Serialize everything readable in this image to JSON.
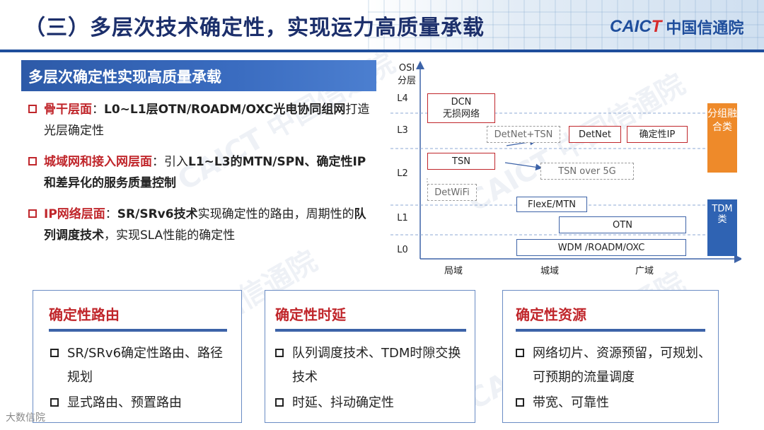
{
  "header": {
    "title": "（三）多层次技术确定性，实现运力高质量承载",
    "logo_mark_a": "CAIC",
    "logo_mark_b": "T",
    "logo_cn": "中国信通院"
  },
  "section": {
    "title": "多层次确定性实现高质量承载"
  },
  "bullets": [
    {
      "lead": "骨干层面",
      "sep": "：",
      "bold": "L0~L1层OTN/ROADM/OXC光电协同组网",
      "rest": "打造光层确定性"
    },
    {
      "lead": "城域网和接入网层面",
      "sep": "：引入",
      "bold": "L1~L3的MTN/SPN、确定性IP和差异化的服务质量控制",
      "rest": ""
    },
    {
      "lead": "IP网络层面",
      "sep": "：",
      "bold": "SR/SRv6技术",
      "rest": "实现确定性的路由，周期性的",
      "bold2": "队列调度技术",
      "rest2": "，实现SLA性能的确定性"
    }
  ],
  "diagram": {
    "y_axis_title_line1": "OSI",
    "y_axis_title_line2": "分层",
    "levels": [
      "L4",
      "L3",
      "L2",
      "L1",
      "L0"
    ],
    "x_labels": [
      "局域",
      "城域",
      "广域"
    ],
    "boxes": {
      "dcn": "DCN",
      "dcn_sub": "无损网络",
      "detnet_tsn": "DetNet+TSN",
      "detnet": "DetNet",
      "det_ip": "确定性IP",
      "tsn": "TSN",
      "tsn_5g": "TSN over 5G",
      "detwifi": "DetWiFi",
      "flexe": "FlexE/MTN",
      "otn": "OTN",
      "wdm": "WDM /ROADM/OXC"
    },
    "side_packet": "分组融合类",
    "side_tdm": "TDM类",
    "colors": {
      "packet": "#ee8a2a",
      "tdm": "#2f63b3",
      "accent_red": "#c0262b"
    }
  },
  "cards": [
    {
      "title": "确定性路由",
      "items": [
        "SR/SRv6确定性路由、路径规划",
        "显式路由、预置路由"
      ]
    },
    {
      "title": "确定性时延",
      "items": [
        "队列调度技术、TDM时隙交换技术",
        "时延、抖动确定性"
      ]
    },
    {
      "title": "确定性资源",
      "items": [
        "网络切片、资源预留，可规划、可预期的流量调度",
        "带宽、可靠性"
      ]
    }
  ],
  "watermark": "CAICT 中国信通院",
  "source_mark": "大数信院"
}
